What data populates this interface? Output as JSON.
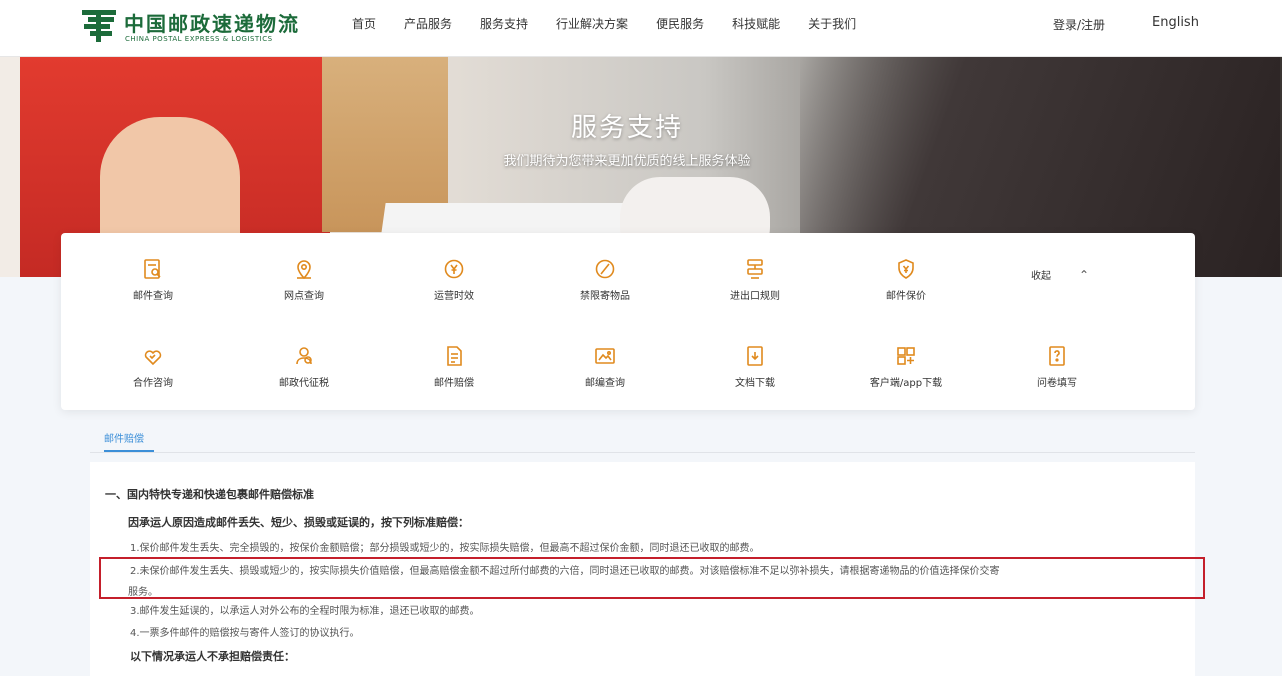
{
  "header": {
    "logo_cn": "中国邮政速递物流",
    "logo_en": "CHINA POSTAL EXPRESS & LOGISTICS",
    "nav": [
      "首页",
      "产品服务",
      "服务支持",
      "行业解决方案",
      "便民服务",
      "科技赋能",
      "关于我们"
    ],
    "login": "登录/注册",
    "language": "English"
  },
  "hero": {
    "title": "服务支持",
    "subtitle": "我们期待为您带来更加优质的线上服务体验"
  },
  "services": {
    "row1": [
      {
        "label": "邮件查询",
        "icon": "document-search-icon"
      },
      {
        "label": "网点查询",
        "icon": "location-pin-icon"
      },
      {
        "label": "运营时效",
        "icon": "clock-yen-icon"
      },
      {
        "label": "禁限寄物品",
        "icon": "prohibited-icon"
      },
      {
        "label": "进出口规则",
        "icon": "customs-icon"
      },
      {
        "label": "邮件保价",
        "icon": "shield-icon"
      }
    ],
    "row2": [
      {
        "label": "合作咨询",
        "icon": "handshake-icon"
      },
      {
        "label": "邮政代征税",
        "icon": "tax-person-icon"
      },
      {
        "label": "邮件赔偿",
        "icon": "compensation-doc-icon"
      },
      {
        "label": "邮编查询",
        "icon": "postcode-icon"
      },
      {
        "label": "文档下载",
        "icon": "download-doc-icon"
      },
      {
        "label": "客户端/app下载",
        "icon": "app-grid-icon"
      },
      {
        "label": "问卷填写",
        "icon": "questionnaire-icon"
      }
    ],
    "collapse_label": "收起",
    "collapse_icon": "chevron-up-icon"
  },
  "tab": {
    "label": "邮件赔偿"
  },
  "content": {
    "heading1": "一、国内特快专递和快递包裹邮件赔偿标准",
    "heading2": "因承运人原因造成邮件丢失、短少、损毁或延误的，按下列标准赔偿：",
    "item1": "1.保价邮件发生丢失、完全损毁的，按保价金额赔偿；部分损毁或短少的，按实际损失赔偿，但最高不超过保价金额，同时退还已收取的邮费。",
    "item2a": "2.未保价邮件发生丢失、损毁或短少的，按实际损失价值赔偿，但最高赔偿金额不超过所付邮费的六倍，同时退还已收取的邮费。对该赔偿标准不足以弥补损失，请根据寄递物品的价值选择保价交寄",
    "item2b": "服务。",
    "item3": "3.邮件发生延误的，以承运人对外公布的全程时限为标准，退还已收取的邮费。",
    "item4": "4.一票多件邮件的赔偿按与寄件人签订的协议执行。",
    "heading3": "以下情况承运人不承担赔偿责任："
  },
  "colors": {
    "brand_green": "#1c6b3a",
    "accent_orange": "#e08a1e",
    "tab_blue": "#3c8fd8",
    "highlight_red": "#c41f2b"
  }
}
